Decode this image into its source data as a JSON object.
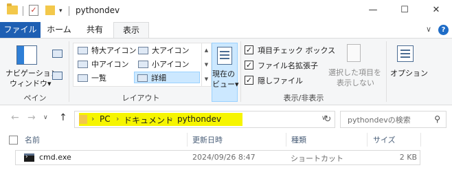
{
  "window": {
    "title": "pythondev"
  },
  "ribbon_tabs": [
    "ファイル",
    "ホーム",
    "共有",
    "表示"
  ],
  "ribbon": {
    "panes": {
      "nav_pane_line1": "ナビゲーション",
      "nav_pane_line2": "ウィンドウ▾",
      "group": "ペイン"
    },
    "layout": {
      "items": [
        "特大アイコン",
        "大アイコン",
        "中アイコン",
        "小アイコン",
        "一覧",
        "詳細"
      ],
      "selected": "詳細",
      "group": "レイアウト"
    },
    "current_view": {
      "line1": "現在の",
      "line2": "ビュー▾"
    },
    "show_hide": {
      "item_checkboxes": "項目チェック ボックス",
      "file_extensions": "ファイル名拡張子",
      "hidden_items": "隠しファイル",
      "hide_selected_line1": "選択した項目を",
      "hide_selected_line2": "表示しない",
      "group": "表示/非表示"
    },
    "options": "オプション"
  },
  "address": {
    "crumbs": [
      "PC",
      "ドキュメント",
      "pythondev"
    ],
    "highlight_color": "#f6f500"
  },
  "search": {
    "placeholder": "pythondevの検索"
  },
  "columns": [
    "名前",
    "更新日時",
    "種類",
    "サイズ"
  ],
  "files": [
    {
      "name": "cmd.exe",
      "modified": "2024/09/26 8:47",
      "type": "ショートカット",
      "size": "2 KB"
    }
  ],
  "accent": "#1e5fb3"
}
